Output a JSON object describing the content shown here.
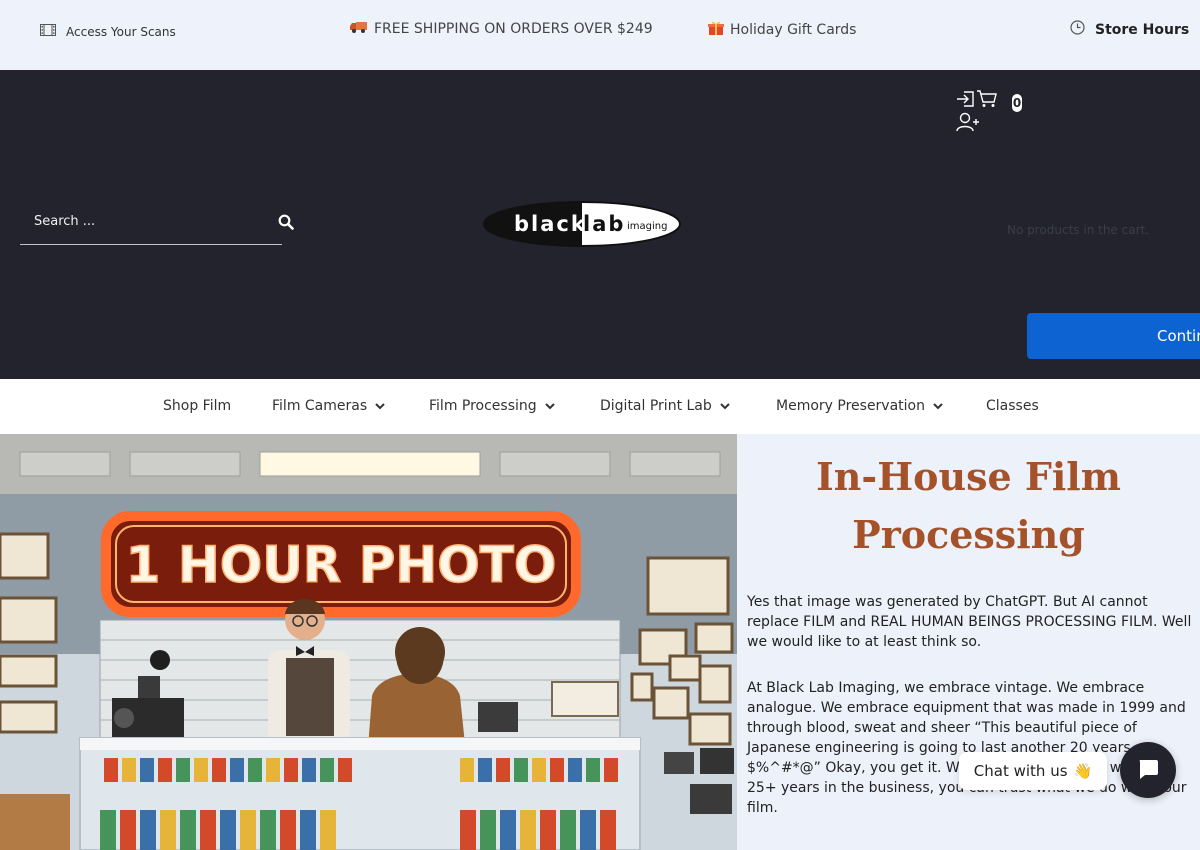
{
  "topbar": {
    "scans_label": "Access Your Scans",
    "shipping_label": "FREE SHIPPING ON ORDERS OVER $249",
    "gift_label": "Holiday Gift Cards",
    "hours_label": "Store Hours"
  },
  "header": {
    "cart_count": "0",
    "search_placeholder": "Search ...",
    "logo": {
      "word1": "black",
      "word2": "lab",
      "word3": "imaging"
    },
    "cart_empty_text": "No products in the cart.",
    "continue_label": "Continue Shopping"
  },
  "nav": {
    "items": [
      {
        "label": "Shop Film",
        "dropdown": false
      },
      {
        "label": "Film Cameras",
        "dropdown": true
      },
      {
        "label": "Film Processing",
        "dropdown": true
      },
      {
        "label": "Digital Print Lab",
        "dropdown": true
      },
      {
        "label": "Memory Preservation",
        "dropdown": true
      },
      {
        "label": "Classes",
        "dropdown": false
      }
    ]
  },
  "hero": {
    "sign_text": "1 HOUR PHOTO"
  },
  "content": {
    "title_line1": "In-House Film",
    "title_line2": "Processing",
    "para1": "Yes that image was generated by ChatGPT. But AI cannot replace FILM and REAL HUMAN BEINGS PROCESSING FILM. Well we would like to at least think so.",
    "para2": "At Black Lab Imaging, we embrace vintage. We embrace analogue. We embrace equipment that was made in 1999 and through blood, sweat and sheer “This beautiful piece of Japanese engineering is going to last another 20 years, $%^#*@” Okay, you get it. We are film nerds. And with our 25+ years in the business, you can trust what we do with your film."
  },
  "chat": {
    "label": "Chat with us",
    "emoji": "👋"
  },
  "colors": {
    "topbar_bg": "#eef3fb",
    "header_bg": "#23232e",
    "accent_blue": "#0d63d1",
    "title_brown": "#a5522a",
    "side_bg": "#edf2fa"
  }
}
